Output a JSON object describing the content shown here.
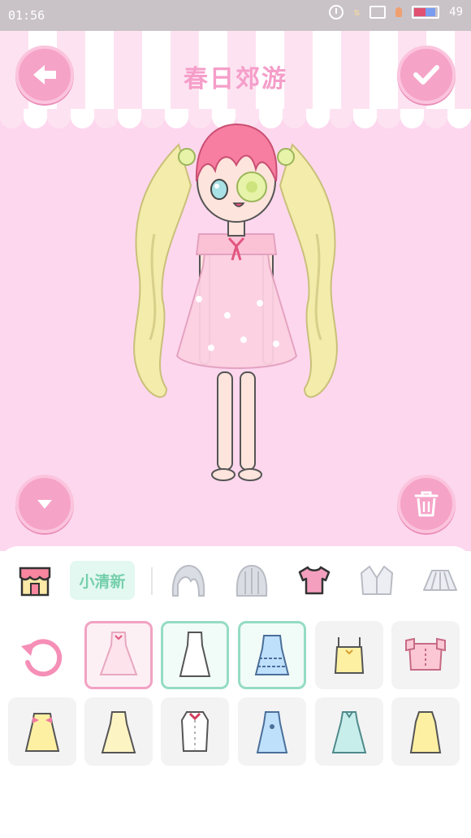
{
  "status_bar": {
    "time": "01:56",
    "battery": "49"
  },
  "header": {
    "title": "春日郊游"
  },
  "category_bar": {
    "active_label": "小清新",
    "icons": [
      "shop-icon",
      "hair-front-icon",
      "hair-back-icon",
      "top-icon",
      "coat-icon",
      "skirt-icon"
    ]
  },
  "colors": {
    "accent_pink": "#f6a3c8",
    "accent_mint": "#76cfac",
    "stage_bg": "#fdd7ee"
  },
  "items_row1": [
    "pink-dress",
    "white-dress",
    "blue-frill-dress",
    "yellow-camisole",
    "pink-frill-top"
  ],
  "items_row2": [
    "yellow-bow-dress",
    "yellow-slip-dress",
    "white-blouse",
    "blue-bow-dress",
    "mint-dress",
    "yellow-dress"
  ],
  "selected_items": [
    "pink-dress",
    "white-dress",
    "blue-frill-dress"
  ]
}
